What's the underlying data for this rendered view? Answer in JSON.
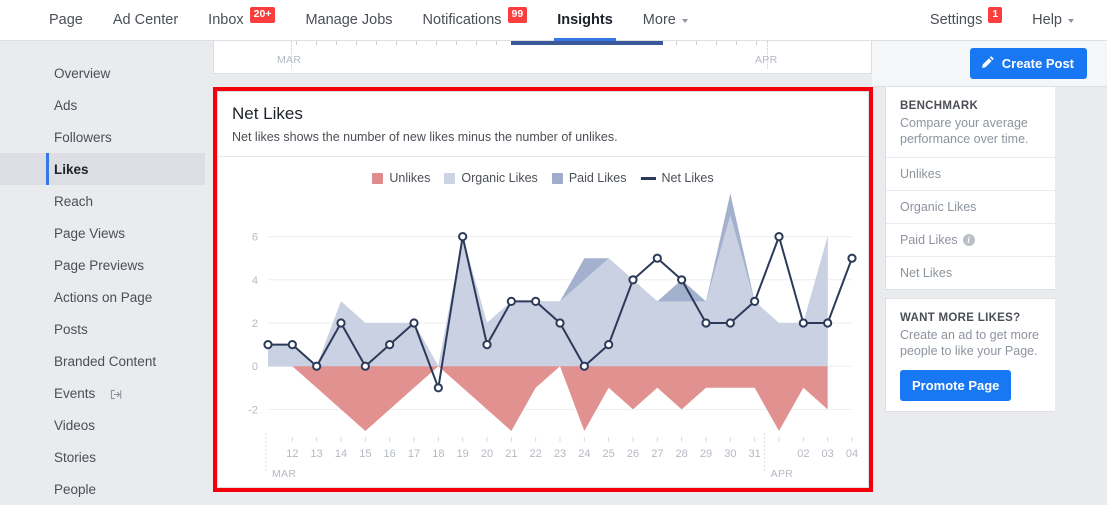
{
  "topnav": {
    "left_items": [
      {
        "label": "Page",
        "badge": null,
        "caret": false,
        "active": false
      },
      {
        "label": "Ad Center",
        "badge": null,
        "caret": false,
        "active": false
      },
      {
        "label": "Inbox",
        "badge": "20+",
        "caret": false,
        "active": false
      },
      {
        "label": "Manage Jobs",
        "badge": null,
        "caret": false,
        "active": false
      },
      {
        "label": "Notifications",
        "badge": "99",
        "caret": false,
        "active": false
      },
      {
        "label": "Insights",
        "badge": null,
        "caret": false,
        "active": true
      },
      {
        "label": "More",
        "badge": null,
        "caret": true,
        "active": false
      }
    ],
    "right_items": [
      {
        "label": "Settings",
        "badge": "1",
        "caret": false,
        "active": false
      },
      {
        "label": "Help",
        "badge": null,
        "caret": true,
        "active": false
      }
    ]
  },
  "sidebar": {
    "items": [
      {
        "label": "Overview",
        "active": false,
        "icon": null
      },
      {
        "label": "Ads",
        "active": false,
        "icon": null
      },
      {
        "label": "Followers",
        "active": false,
        "icon": null
      },
      {
        "label": "Likes",
        "active": true,
        "icon": null
      },
      {
        "label": "Reach",
        "active": false,
        "icon": null
      },
      {
        "label": "Page Views",
        "active": false,
        "icon": null
      },
      {
        "label": "Page Previews",
        "active": false,
        "icon": null
      },
      {
        "label": "Actions on Page",
        "active": false,
        "icon": null
      },
      {
        "label": "Posts",
        "active": false,
        "icon": null
      },
      {
        "label": "Branded Content",
        "active": false,
        "icon": null
      },
      {
        "label": "Events",
        "active": false,
        "icon": "external-link-icon"
      },
      {
        "label": "Videos",
        "active": false,
        "icon": null
      },
      {
        "label": "Stories",
        "active": false,
        "icon": null
      },
      {
        "label": "People",
        "active": false,
        "icon": null
      }
    ]
  },
  "partial_card": {
    "month_left": "MAR",
    "month_right": "APR"
  },
  "card": {
    "title": "Net Likes",
    "subtitle": "Net likes shows the number of new likes minus the number of unlikes."
  },
  "colors": {
    "unlikes": "#e08b8b",
    "organic_likes": "#ccd3e3",
    "paid_likes": "#9fadcb",
    "net_likes": "#2c3a5a",
    "accent_blue": "#1877f2",
    "highlight_red": "#f3000a",
    "grid": "#edeef1",
    "axis_text": "#b4b9c4"
  },
  "chart_data": {
    "type": "area",
    "title": "Net Likes",
    "xlabel": "",
    "ylabel": "",
    "ylim": [
      -3,
      7
    ],
    "yticks": [
      6,
      4,
      2,
      0,
      -2
    ],
    "grid": true,
    "legend_position": "top-center",
    "month_markers": [
      {
        "label": "MAR",
        "at_index": 0
      },
      {
        "label": "APR",
        "at_index": 20
      }
    ],
    "categories": [
      "12",
      "13",
      "14",
      "15",
      "16",
      "17",
      "18",
      "19",
      "20",
      "21",
      "22",
      "23",
      "24",
      "25",
      "26",
      "27",
      "28",
      "29",
      "30",
      "31",
      "",
      "02",
      "03",
      "04"
    ],
    "series": [
      {
        "name": "Unlikes",
        "color": "#e08b8b",
        "type": "area-negative",
        "values": [
          0,
          0,
          -1,
          -2,
          -3,
          -2,
          -1,
          0,
          -1,
          -2,
          -3,
          -1,
          0,
          -3,
          -1,
          -2,
          -1,
          -2,
          -1,
          -1,
          -1,
          -3,
          -1,
          -2
        ]
      },
      {
        "name": "Organic Likes",
        "color": "#ccd3e3",
        "type": "area",
        "values": [
          1,
          1,
          0,
          3,
          2,
          2,
          2,
          0,
          6,
          2,
          3,
          3,
          3,
          4,
          5,
          4,
          3,
          3,
          3,
          7,
          3,
          2,
          2,
          6
        ]
      },
      {
        "name": "Paid Likes",
        "color": "#9fadcb",
        "type": "area",
        "values": [
          0,
          0,
          0,
          0,
          0,
          0,
          0,
          0,
          0,
          0,
          0,
          0,
          0,
          1,
          0,
          0,
          0,
          1,
          0,
          1,
          0,
          0,
          0,
          0
        ]
      },
      {
        "name": "Net Likes",
        "color": "#2c3a5a",
        "type": "line",
        "values": [
          1,
          1,
          0,
          2,
          0,
          1,
          2,
          -1,
          6,
          1,
          3,
          3,
          2,
          0,
          1,
          4,
          5,
          4,
          2,
          2,
          3,
          6,
          2,
          2,
          5
        ]
      }
    ],
    "legend": [
      {
        "label": "Unlikes",
        "color": "#e08b8b",
        "shape": "square"
      },
      {
        "label": "Organic Likes",
        "color": "#ccd3e3",
        "shape": "square"
      },
      {
        "label": "Paid Likes",
        "color": "#9fadcb",
        "shape": "square"
      },
      {
        "label": "Net Likes",
        "color": "#2c3a5a",
        "shape": "line"
      }
    ]
  },
  "rail": {
    "create_post_label": "Create Post",
    "benchmark": {
      "heading": "BENCHMARK",
      "description": "Compare your average performance over time.",
      "rows": [
        {
          "label": "Unlikes",
          "info": false
        },
        {
          "label": "Organic Likes",
          "info": false
        },
        {
          "label": "Paid Likes",
          "info": true
        },
        {
          "label": "Net Likes",
          "info": false
        }
      ]
    },
    "promo": {
      "heading": "WANT MORE LIKES?",
      "description": "Create an ad to get more people to like your Page.",
      "button_label": "Promote Page"
    }
  }
}
